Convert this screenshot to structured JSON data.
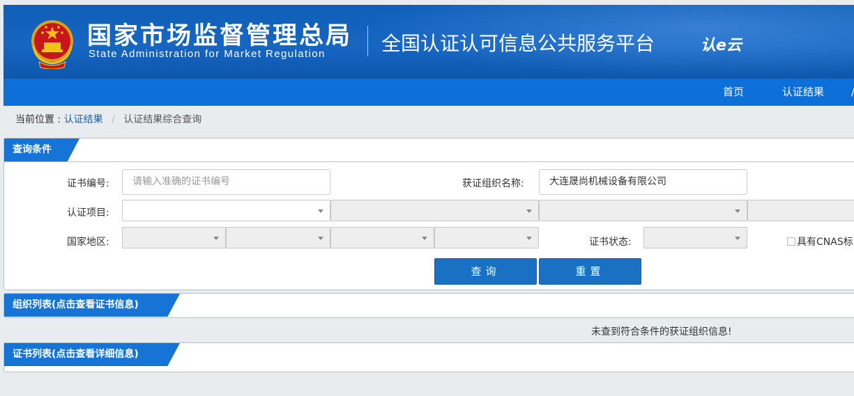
{
  "header": {
    "org_cn": "国家市场监督管理总局",
    "org_en": "State Administration  for  Market Regulation",
    "platform": "全国认证认可信息公共服务平台",
    "cloud_logo": "认e云"
  },
  "nav": {
    "items": [
      "首页",
      "认证结果",
      "/"
    ]
  },
  "breadcrumb": {
    "label": "当前位置 :",
    "link": "认证结果",
    "separator": "/",
    "current": "认证结果综合查询"
  },
  "query_panel": {
    "title": "查询条件",
    "cert_no_label": "证书编号:",
    "cert_no_placeholder": "请输入准确的证书编号",
    "org_name_label": "获证组织名称:",
    "org_name_value": "大连晟尚机械设备有限公司",
    "project_label": "认证项目:",
    "region_label": "国家地区:",
    "status_label": "证书状态:",
    "cnas_label": "具有CNAS标",
    "search_button": "查询",
    "reset_button": "重置"
  },
  "org_list": {
    "title": "组织列表(点击查看证书信息)",
    "empty_message": "未查到符合条件的获证组织信息!"
  },
  "cert_list": {
    "title": "证书列表(点击查看详细信息)"
  },
  "colors": {
    "nav_blue": "#0d6fd8",
    "header_blue": "#1666c2",
    "tab_blue": "#1574d6",
    "button_blue": "#1a70c2",
    "link_blue": "#1a5fa8"
  }
}
